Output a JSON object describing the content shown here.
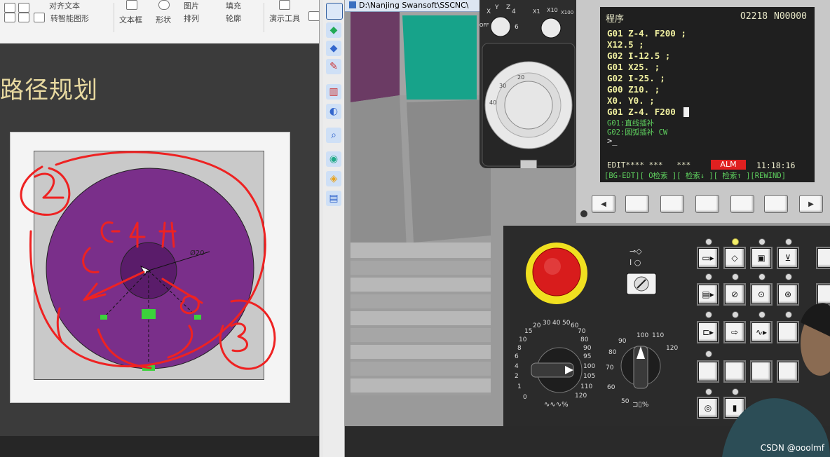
{
  "ppt": {
    "ribbon": {
      "row1_items": [
        "对齐文本",
        "填充"
      ],
      "row2_items": [
        "转智能图形",
        "文本框",
        "形状",
        "排列",
        "轮廓",
        "演示工具"
      ],
      "row1_extra": "图片"
    },
    "slide": {
      "title": "路径规划",
      "drawing_label": "Ø20",
      "annotations": [
        "②",
        "G4",
        "①",
        "④",
        "③"
      ]
    }
  },
  "sim": {
    "title": "D:\\Nanjing Swansoft\\SSCNC\\",
    "handwheel": {
      "axis_labels": [
        "X",
        "Y",
        "Z",
        "4",
        "OFF",
        "6"
      ],
      "scale_labels": [
        "X1",
        "X10",
        "X100"
      ],
      "dial_marks": [
        "20",
        "30",
        "40"
      ]
    },
    "crt": {
      "mode": "程序",
      "program": "O2218",
      "block": "N00000",
      "lines": [
        "G01 Z-4. F200 ;",
        "X12.5 ;",
        "G02 I-12.5 ;",
        "G01 X25. ;",
        "G02 I-25. ;",
        "G00 Z10. ;",
        "X0. Y0. ;",
        "G01 Z-4. F200"
      ],
      "notes": [
        "G01:直线插补",
        "G02:圆弧插补 CW"
      ],
      "prompt": ">_",
      "status_mode": "EDIT**** ***   ***",
      "alarm": "ALM",
      "time": "11:18:16",
      "softkeys": "[BG-EDT][ O检索 ][ 检索↓ ][ 检索↑ ][REWIND]"
    },
    "feed_dial": {
      "labels": [
        "0",
        "1",
        "2",
        "4",
        "6",
        "8",
        "10",
        "15",
        "20",
        "30",
        "40",
        "50",
        "60",
        "70",
        "80",
        "90",
        "95",
        "100",
        "105",
        "110",
        "120"
      ],
      "unit": "%"
    },
    "spindle_dial": {
      "labels": [
        "50",
        "60",
        "70",
        "80",
        "90",
        "100",
        "110",
        "120"
      ],
      "unit": "%"
    },
    "colors": {
      "crt_text": "#f0f0a0",
      "crt_note": "#5fd25f",
      "alarm": "#e02020",
      "estop": "#d81c1c",
      "drawing_part": "#7a2f8a",
      "annotation": "#ee2222"
    }
  },
  "watermark": "CSDN @ooolmf"
}
